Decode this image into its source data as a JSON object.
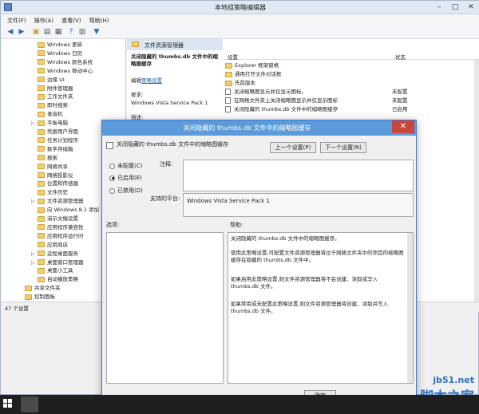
{
  "window": {
    "title": "本地组策略编辑器"
  },
  "menu": [
    "文件(F)",
    "操作(A)",
    "查看(V)",
    "帮助(H)"
  ],
  "tree": {
    "items": [
      {
        "label": "Windows 更新",
        "indent": 2
      },
      {
        "label": "Windows 日历",
        "indent": 2
      },
      {
        "label": "Windows 颜色系统",
        "indent": 2
      },
      {
        "label": "Windows 移动中心",
        "indent": 2
      },
      {
        "label": "边缘 UI",
        "indent": 2
      },
      {
        "label": "附件管理器",
        "indent": 2
      },
      {
        "label": "工作文件夹",
        "indent": 2
      },
      {
        "label": "即时搜索",
        "indent": 2
      },
      {
        "label": "录音机",
        "indent": 2
      },
      {
        "label": "平板电脑",
        "indent": 2,
        "expander": "▷"
      },
      {
        "label": "凭据用户界面",
        "indent": 2
      },
      {
        "label": "任务计划程序",
        "indent": 2
      },
      {
        "label": "数字存储箱",
        "indent": 2
      },
      {
        "label": "搜索",
        "indent": 2
      },
      {
        "label": "网络共享",
        "indent": 2
      },
      {
        "label": "网络投影仪",
        "indent": 2
      },
      {
        "label": "位置和传感器",
        "indent": 2
      },
      {
        "label": "文件历史",
        "indent": 2
      },
      {
        "label": "文件资源管理器",
        "indent": 2,
        "expander": "▷"
      },
      {
        "label": "向 Windows 8.1 添加",
        "indent": 2
      },
      {
        "label": "演示文稿设置",
        "indent": 2
      },
      {
        "label": "应用程序兼容性",
        "indent": 2
      },
      {
        "label": "应用程序运行时",
        "indent": 2
      },
      {
        "label": "应用商店",
        "indent": 2
      },
      {
        "label": "远程桌面服务",
        "indent": 2,
        "expander": "▷"
      },
      {
        "label": "桌面窗口管理器",
        "indent": 2,
        "expander": "▷"
      },
      {
        "label": "桌面小工具",
        "indent": 2
      },
      {
        "label": "自动播放策略",
        "indent": 2
      },
      {
        "label": "共享文件夹",
        "indent": 1
      },
      {
        "label": "控制面板",
        "indent": 1
      }
    ]
  },
  "status_bar": {
    "text": "47 个设置"
  },
  "right": {
    "section_title": "文件资源管理器",
    "policy_title": "关闭隐藏的 thumbs.db 文件中的缩略图缓存",
    "edit_prefix": "编辑",
    "edit_link": "策略设置",
    "req_label": "要求:",
    "req_value": "Windows Vista Service Pack 1",
    "desc_label": "描述:",
    "col_setting": "设置",
    "col_status": "状态",
    "rows": [
      {
        "name": "Explorer 框架窗格",
        "status": "",
        "folder": true
      },
      {
        "name": "通用打开文件对话框",
        "status": "",
        "folder": true
      },
      {
        "name": "先前版本",
        "status": "",
        "folder": true
      },
      {
        "name": "关闭缩略图显示并仅显示图标。",
        "status": "未配置",
        "folder": false
      },
      {
        "name": "在网络文件夹上关闭缩略图显示并仅显示图标",
        "status": "未配置",
        "folder": false
      },
      {
        "name": "关闭隐藏的 thumbs.db 文件中的缩略图缓存",
        "status": "已启用",
        "folder": false
      }
    ]
  },
  "dialog": {
    "title": "关闭隐藏的 thumbs.db 文件中的缩略图缓存",
    "header": "关闭隐藏的 thumbs.db 文件中的缩略图缓存",
    "prev_button": "上一个设置(P)",
    "next_button": "下一个设置(N)",
    "radio_unconfigured": "未配置(C)",
    "radio_enabled": "已启用(E)",
    "radio_disabled": "已禁用(D)",
    "selected": "enabled",
    "comment_label": "注释:",
    "platform_label": "支持的平台:",
    "platform_value": "Windows Vista Service Pack 1",
    "options_label": "选项:",
    "help_label": "帮助:",
    "help_text": [
      "关闭隐藏的 thumbs.db 文件中的缩略图缓存。",
      "使用此策略设置,可配置文件资源管理器将位于网络文件夹中的项目的缩略图缓存在隐藏的 thumbs.db 文件中。",
      "如果启用此策略设置,则文件资源管理器将不会创建、读取或写入 thumbs.db 文件。",
      "如果禁用或未配置此策略设置,则文件资源管理器将创建、读取并写入 thumbs.db 文件。"
    ],
    "ok_button": "确定"
  },
  "watermark": {
    "site": "jb51.net",
    "name": "脚本之家"
  }
}
